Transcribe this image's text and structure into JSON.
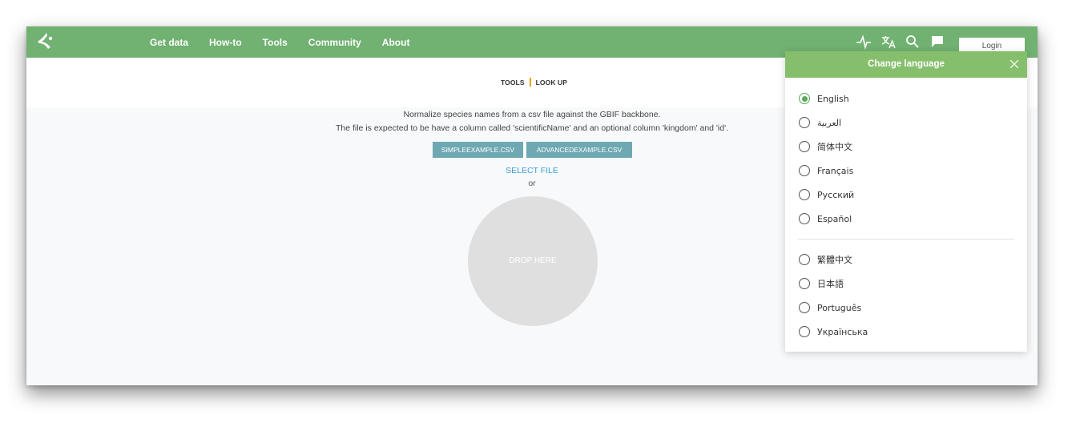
{
  "nav": {
    "links": [
      "Get data",
      "How-to",
      "Tools",
      "Community",
      "About"
    ],
    "icons": [
      "activity-icon",
      "translate-icon",
      "search-icon",
      "feedback-icon"
    ],
    "login_label": "Login"
  },
  "breadcrumb": {
    "parent": "TOOLS",
    "current": "LOOK UP"
  },
  "main": {
    "description_line1": "Normalize species names from a csv file against the GBIF backbone.",
    "description_line2": "The file is expected to be have a column called 'scientificName' and an optional column 'kingdom' and 'id'.",
    "simple_example_label": "SIMPLEEXAMPLE.CSV",
    "advanced_example_label": "ADVANCEDEXAMPLE.CSV",
    "select_file_label": "SELECT FILE",
    "or_label": "or",
    "drop_label": "DROP HERE"
  },
  "language_panel": {
    "title": "Change language",
    "selected": "English",
    "languages": [
      "English",
      "العربية",
      "简体中文",
      "Français",
      "Русский",
      "Español",
      "繁體中文",
      "日本語",
      "Português",
      "Українська"
    ]
  },
  "colors": {
    "navbar": "#71b171",
    "panel_header": "#86bf6c",
    "example_button": "#6ea8b2",
    "link": "#3a9fd6",
    "breadcrumb_separator": "#f0a100"
  }
}
